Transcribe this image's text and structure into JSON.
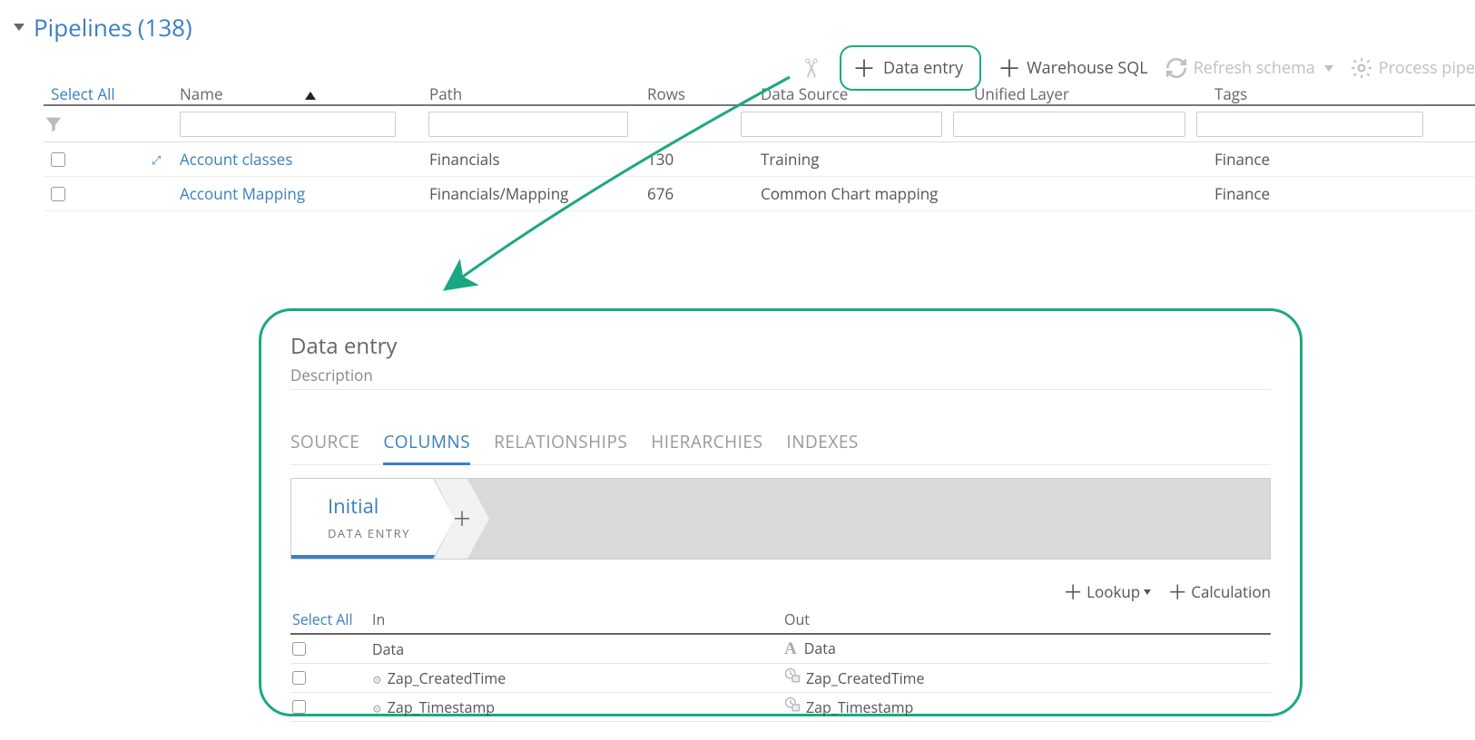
{
  "header": {
    "title_label": "Pipelines",
    "title_count": "(138)"
  },
  "toolbar": {
    "data_entry_label": "Data entry",
    "warehouse_sql_label": "Warehouse SQL",
    "refresh_schema_label": "Refresh schema",
    "process_pipe_label": "Process pipe"
  },
  "pipe_table": {
    "select_all_label": "Select All",
    "headers": {
      "name": "Name",
      "path": "Path",
      "rows": "Rows",
      "data_source": "Data Source",
      "unified_layer": "Unified Layer",
      "tags": "Tags"
    },
    "rows": [
      {
        "name": "Account classes",
        "path": "Financials",
        "rows": "130",
        "data_source": "Training",
        "unified_layer": "",
        "tags": "Finance"
      },
      {
        "name": "Account Mapping",
        "path": "Financials/Mapping",
        "rows": "676",
        "data_source": "Common Chart mapping",
        "unified_layer": "",
        "tags": "Finance"
      }
    ]
  },
  "detail": {
    "title": "Data entry",
    "description_label": "Description",
    "tabs": {
      "source": "SOURCE",
      "columns": "COLUMNS",
      "relationships": "RELATIONSHIPS",
      "hierarchies": "HIERARCHIES",
      "indexes": "INDEXES"
    },
    "step": {
      "name": "Initial",
      "sub": "DATA ENTRY"
    },
    "col_toolbar": {
      "lookup_label": "Lookup",
      "calculation_label": "Calculation"
    },
    "col_table": {
      "select_all_label": "Select All",
      "in_label": "In",
      "out_label": "Out",
      "rows": [
        {
          "in": "Data",
          "out": "Data",
          "kind": "text"
        },
        {
          "in": "Zap_CreatedTime",
          "out": "Zap_CreatedTime",
          "kind": "time"
        },
        {
          "in": "Zap_Timestamp",
          "out": "Zap_Timestamp",
          "kind": "time"
        }
      ]
    }
  }
}
